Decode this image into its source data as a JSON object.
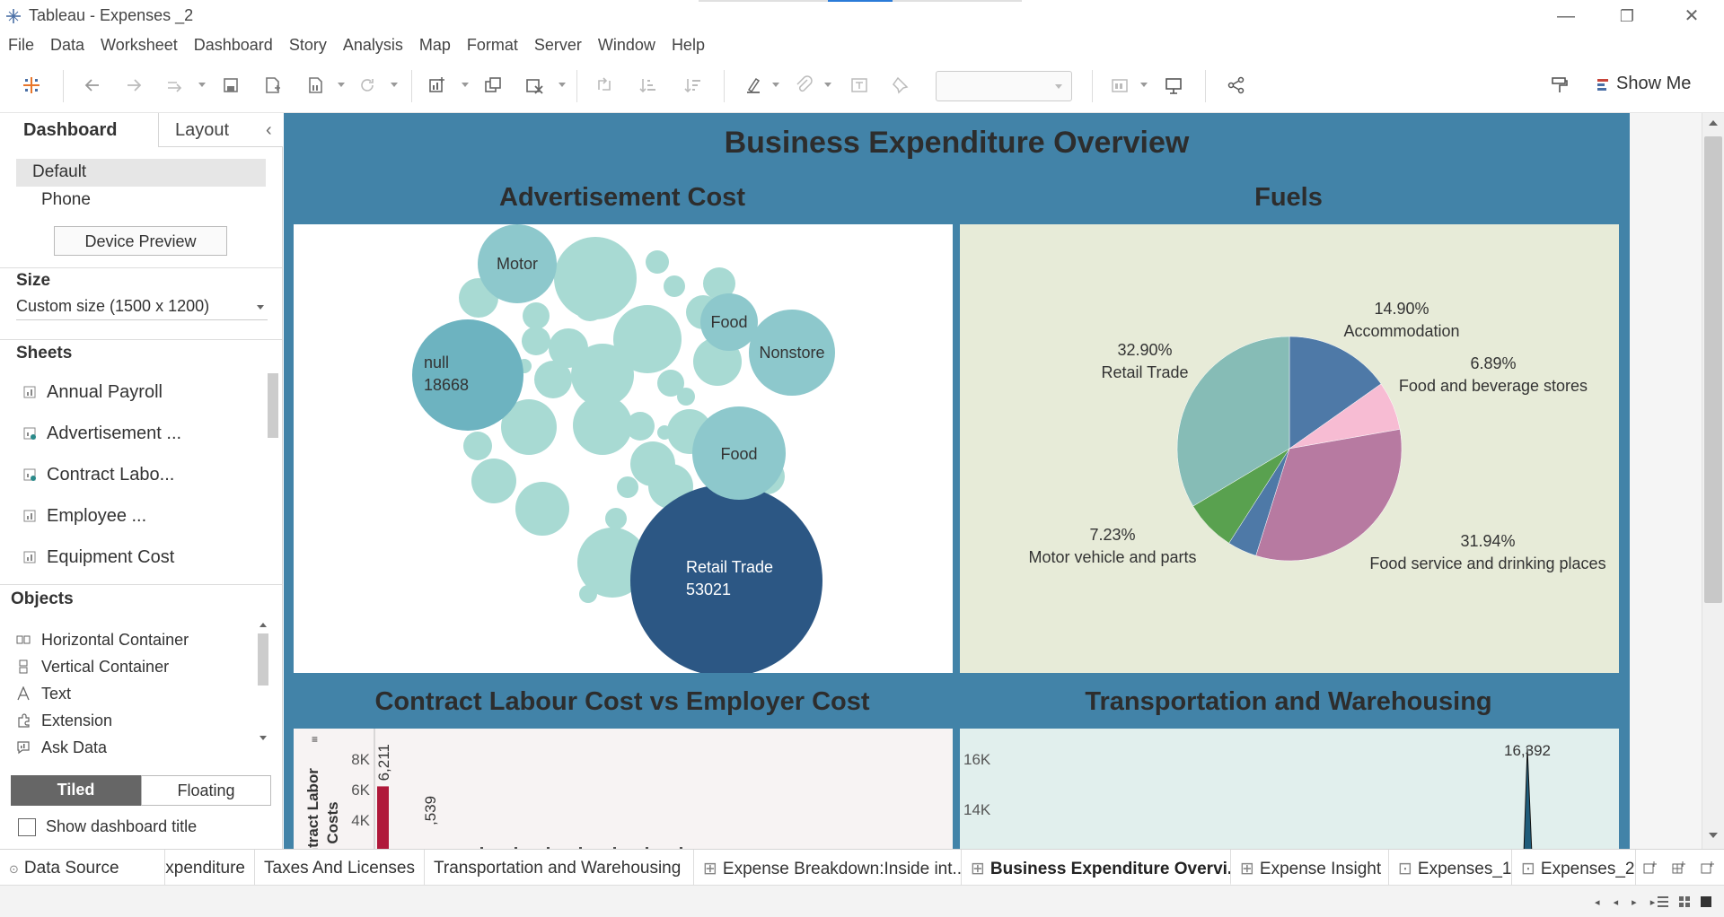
{
  "window": {
    "title": "Tableau - Expenses _2",
    "minimize_glyph": "—",
    "restore_glyph": "❐",
    "close_glyph": "✕"
  },
  "menu": [
    "File",
    "Data",
    "Worksheet",
    "Dashboard",
    "Story",
    "Analysis",
    "Map",
    "Format",
    "Server",
    "Window",
    "Help"
  ],
  "toolbar": {
    "show_me_label": "Show Me",
    "icons": [
      "tableau-logo-icon",
      "undo-icon",
      "redo-icon",
      "replay-icon",
      "save-icon",
      "new-datasource-icon",
      "pause-autoupdate-icon",
      "refresh-icon",
      "new-worksheet-icon",
      "duplicate-icon",
      "clear-icon",
      "swap-icon",
      "sort-asc-icon",
      "sort-desc-icon",
      "highlight-icon",
      "group-icon",
      "label-icon",
      "pin-icon",
      "fit-combo",
      "cards-icon",
      "presentation-icon",
      "share-icon",
      "format-painter-icon"
    ]
  },
  "left_pane": {
    "tab_dashboard": "Dashboard",
    "tab_layout": "Layout",
    "collapse_glyph": "‹",
    "device_default": "Default",
    "device_phone": "Phone",
    "device_preview_button": "Device Preview",
    "size_heading": "Size",
    "size_value": "Custom size (1500 x 1200)",
    "sheets_heading": "Sheets",
    "sheets": [
      "Annual Payroll",
      "Advertisement ...",
      "Contract Labo...",
      "Employee ...",
      "Equipment Cost"
    ],
    "objects_heading": "Objects",
    "objects": [
      "Horizontal Container",
      "Vertical Container",
      "Text",
      "Extension",
      "Ask Data"
    ],
    "tiled_label": "Tiled",
    "floating_label": "Floating",
    "show_title_label": "Show dashboard title"
  },
  "dashboard": {
    "title": "Business Expenditure Overview",
    "background_color": "#4283a8",
    "panels": {
      "advertisement": "Advertisement Cost",
      "fuels": "Fuels",
      "contract": "Contract Labour Cost vs Employer Cost",
      "transport": "Transportation  and Warehousing"
    }
  },
  "chart_data": [
    {
      "type": "bubble",
      "title": "Advertisement Cost",
      "labeled_bubbles": [
        {
          "name": "Retail Trade",
          "value": 53021,
          "color": "#2c5784"
        },
        {
          "name": "null",
          "value": 18668,
          "color": "#6db3c0"
        },
        {
          "name": "Motor",
          "color": "#8dc8cc"
        },
        {
          "name": "Food",
          "color": "#8dc8cc"
        },
        {
          "name": "Nonstore",
          "color": "#8dc8cc"
        },
        {
          "name": "Food",
          "color": "#8dc8cc"
        }
      ],
      "unlabeled_color": "#a8dad3"
    },
    {
      "type": "pie",
      "title": "Fuels",
      "slices": [
        {
          "label": "Accommodation",
          "percent": 14.9,
          "display": "14.90%",
          "color": "#4e79a7"
        },
        {
          "label": "Food and beverage stores",
          "percent": 6.89,
          "display": "6.89%",
          "color": "#f7bcd3"
        },
        {
          "label": "Food service and drinking places",
          "percent": 31.94,
          "display": "31.94%",
          "color": "#b77aa1"
        },
        {
          "label": "",
          "percent": 4.14,
          "display": "",
          "color": "#4e79a7"
        },
        {
          "label": "Motor vehicle and parts",
          "percent": 7.23,
          "display": "7.23%",
          "color": "#59a14f"
        },
        {
          "label": "Retail Trade",
          "percent": 32.9,
          "display": "32.90%",
          "color": "#86bcb6"
        }
      ]
    },
    {
      "type": "bar",
      "title": "Contract Labour Cost vs Employer Cost",
      "ylabel": "Contract Labor Costs",
      "y_ticks": [
        "8K",
        "6K",
        "4K"
      ],
      "ylim": [
        0,
        9000
      ],
      "values": [
        6211
      ],
      "value_labels": [
        "6,211",
        ",539"
      ],
      "bar_color": "#b0183a"
    },
    {
      "type": "area",
      "title": "Transportation  and Warehousing",
      "y_ticks": [
        "16K",
        "14K"
      ],
      "peak_label": "16,392",
      "peak_value": 16392
    }
  ],
  "bottom_tabs": [
    "Data Source",
    "Expenditure",
    "Taxes And Licenses",
    "Transportation and Warehousing",
    "Expense Breakdown:Inside int...",
    "Business Expenditure Overvi...",
    "Expense Insight",
    "Expenses_1",
    "Expenses_2"
  ]
}
